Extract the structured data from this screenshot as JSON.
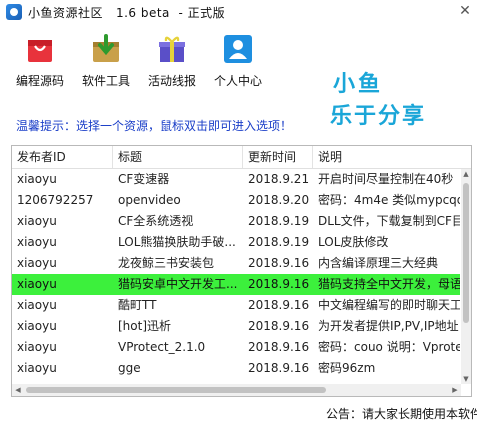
{
  "window": {
    "title": "小鱼资源社区   1.6 beta  - 正式版",
    "close_glyph": "✕"
  },
  "toolbar": [
    {
      "label": "编程源码",
      "icon": "shopping-bag-icon"
    },
    {
      "label": "软件工具",
      "icon": "download-box-icon"
    },
    {
      "label": "活动线报",
      "icon": "gift-box-icon"
    },
    {
      "label": "个人中心",
      "icon": "user-icon"
    }
  ],
  "slogan": {
    "line1": "小鱼",
    "line2": "乐于分享",
    "color": "#1aa6d8"
  },
  "hint": "温馨提示：选择一个资源，鼠标双击即可进入选项！",
  "table": {
    "columns": [
      "发布者ID",
      "标题",
      "更新时间",
      "说明"
    ],
    "rows": [
      {
        "publisher": "xiaoyu",
        "title": "CF变速器",
        "date": "2018.9.21",
        "desc": "开启时间尽量控制在40秒"
      },
      {
        "publisher": "1206792257",
        "title": "openvideo",
        "date": "2018.9.20",
        "desc": "密码：4m4e 类似mypcqq"
      },
      {
        "publisher": "xiaoyu",
        "title": "CF全系统透视",
        "date": "2018.9.19",
        "desc": "DLL文件，下载复制到CF目"
      },
      {
        "publisher": "xiaoyu",
        "title": "LOL熊猫换肤助手破...",
        "date": "2018.9.19",
        "desc": "LOL皮肤修改"
      },
      {
        "publisher": "xiaoyu",
        "title": "龙夜鲸三书安装包",
        "date": "2018.9.16",
        "desc": "内含编译原理三大经典"
      },
      {
        "publisher": "xiaoyu",
        "title": "猎码安卓中文开发工...",
        "date": "2018.9.16",
        "desc": "猎码支持全中文开发，母语",
        "selected": true
      },
      {
        "publisher": "xiaoyu",
        "title": "酷町TT",
        "date": "2018.9.16",
        "desc": "中文编程编写的即时聊天工"
      },
      {
        "publisher": "xiaoyu",
        "title": "[hot]迅析",
        "date": "2018.9.16",
        "desc": "为开发者提供IP,PV,IP地址"
      },
      {
        "publisher": "xiaoyu",
        "title": "VProtect_2.1.0",
        "date": "2018.9.16",
        "desc": "密码：couo 说明：Vprote"
      },
      {
        "publisher": "xiaoyu",
        "title": "gge",
        "date": "2018.9.16",
        "desc": "密码96zm"
      }
    ],
    "selected_color": "#3cf03c"
  },
  "notice": "公告：请大家长期使用本软件"
}
